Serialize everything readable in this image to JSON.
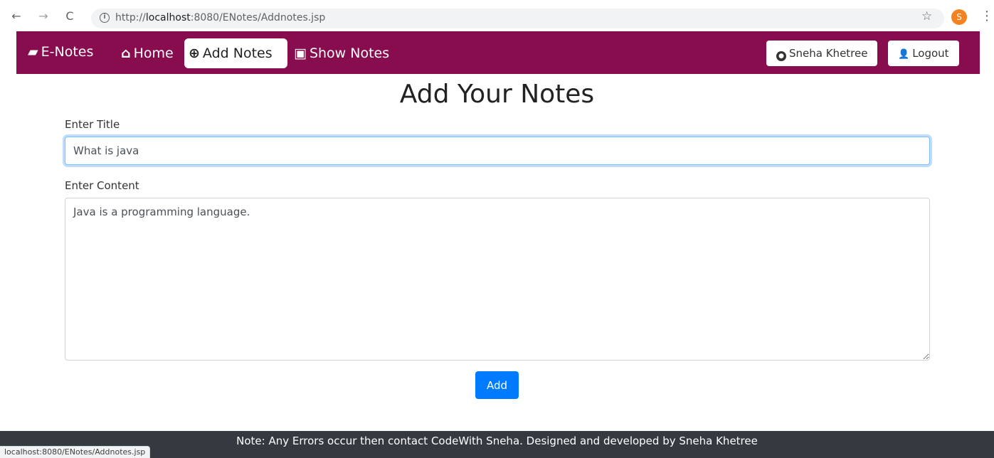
{
  "browser": {
    "url_prefix": "http://",
    "url_host": "localhost",
    "url_rest": ":8080/ENotes/Addnotes.jsp",
    "profile_initial": "S",
    "status_url": "localhost:8080/ENotes/Addnotes.jsp"
  },
  "navbar": {
    "brand": "E-Notes",
    "home": "Home",
    "add_notes": "Add Notes",
    "show_notes": "Show Notes",
    "user": "Sneha Khetree",
    "logout": "Logout",
    "bg_color": "#870d4e"
  },
  "form": {
    "heading": "Add Your Notes",
    "title_label": "Enter Title",
    "title_value": "What is java",
    "content_label": "Enter Content",
    "content_value": "Java is a programming language.",
    "submit_label": "Add"
  },
  "footer": {
    "text": "Note: Any Errors occur then contact CodeWith Sneha. Designed and developed by Sneha Khetree"
  }
}
